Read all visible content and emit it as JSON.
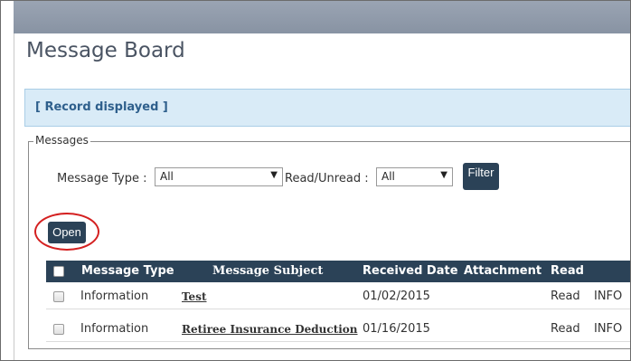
{
  "page": {
    "title": "Message Board"
  },
  "banner": {
    "text": "[ Record displayed ]"
  },
  "messages_section": {
    "legend": "Messages",
    "filters": {
      "message_type_label": "Message Type :",
      "message_type_value": "All",
      "read_unread_label": "Read/Unread :",
      "read_unread_value": "All",
      "filter_button": "Filter"
    },
    "open_button": "Open",
    "table": {
      "columns": [
        "Message Type",
        "Message Subject",
        "Received Date",
        "Attachment",
        "Read"
      ],
      "rows": [
        {
          "type": "Information",
          "subject": "Test",
          "received": "01/02/2015",
          "attachment": "",
          "read": "Read",
          "extra": "INFO"
        },
        {
          "type": "Information",
          "subject": "Retiree Insurance Deduction",
          "received": "01/16/2015",
          "attachment": "",
          "read": "Read",
          "extra": "INFO"
        }
      ]
    }
  },
  "icons": {
    "select_arrow": "triangle-down-icon",
    "checkbox": "checkbox-icon"
  },
  "colors": {
    "header_bar": "#2b4257",
    "banner_bg": "#d9ebf7",
    "banner_text": "#2e5f8c",
    "title_text": "#4a5463",
    "highlight_ellipse": "#d42020"
  }
}
